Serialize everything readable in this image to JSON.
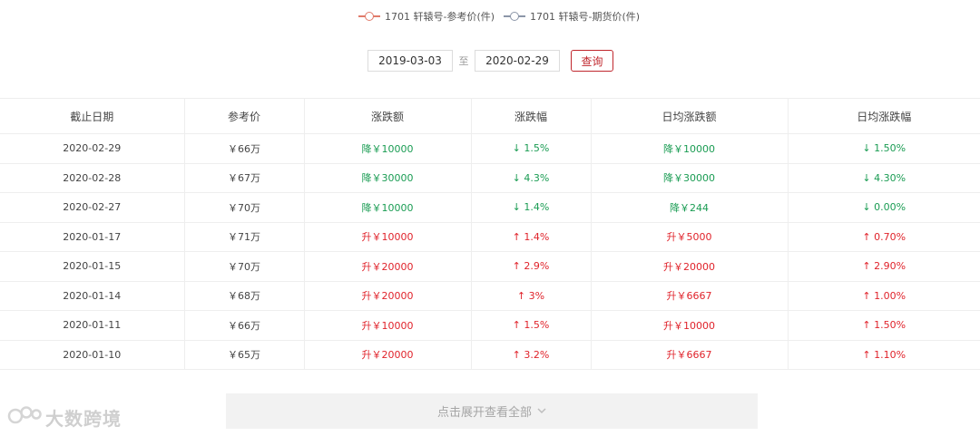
{
  "legend": {
    "items": [
      {
        "label": "1701 轩辕号-参考价(件)",
        "color": "#e07b6b"
      },
      {
        "label": "1701 轩辕号-期货价(件)",
        "color": "#8c96a8"
      }
    ]
  },
  "query": {
    "start_date": "2019-03-03",
    "separator": "至",
    "end_date": "2020-02-29",
    "button_label": "查询"
  },
  "table": {
    "headers": [
      "截止日期",
      "参考价",
      "涨跌额",
      "涨跌幅",
      "日均涨跌额",
      "日均涨跌幅"
    ],
    "rows": [
      {
        "direction": "down",
        "cells": [
          "2020-02-29",
          "￥66万",
          "降￥10000",
          "↓ 1.5%",
          "降￥10000",
          "↓ 1.50%"
        ]
      },
      {
        "direction": "down",
        "cells": [
          "2020-02-28",
          "￥67万",
          "降￥30000",
          "↓ 4.3%",
          "降￥30000",
          "↓ 4.30%"
        ]
      },
      {
        "direction": "down",
        "cells": [
          "2020-02-27",
          "￥70万",
          "降￥10000",
          "↓ 1.4%",
          "降￥244",
          "↓ 0.00%"
        ]
      },
      {
        "direction": "up",
        "cells": [
          "2020-01-17",
          "￥71万",
          "升￥10000",
          "↑ 1.4%",
          "升￥5000",
          "↑ 0.70%"
        ]
      },
      {
        "direction": "up",
        "cells": [
          "2020-01-15",
          "￥70万",
          "升￥20000",
          "↑ 2.9%",
          "升￥20000",
          "↑ 2.90%"
        ]
      },
      {
        "direction": "up",
        "cells": [
          "2020-01-14",
          "￥68万",
          "升￥20000",
          "↑ 3%",
          "升￥6667",
          "↑ 1.00%"
        ]
      },
      {
        "direction": "up",
        "cells": [
          "2020-01-11",
          "￥66万",
          "升￥10000",
          "↑ 1.5%",
          "升￥10000",
          "↑ 1.50%"
        ]
      },
      {
        "direction": "up",
        "cells": [
          "2020-01-10",
          "￥65万",
          "升￥20000",
          "↑ 3.2%",
          "升￥6667",
          "↑ 1.10%"
        ]
      }
    ]
  },
  "expand": {
    "label": "点击展开查看全部",
    "icon": "chevron-down-icon"
  },
  "watermark": {
    "text": "大数跨境",
    "icon": "brand-logo-icon"
  },
  "colors": {
    "up": "#e0232b",
    "down": "#1a9c53",
    "accent": "#c0272d"
  }
}
